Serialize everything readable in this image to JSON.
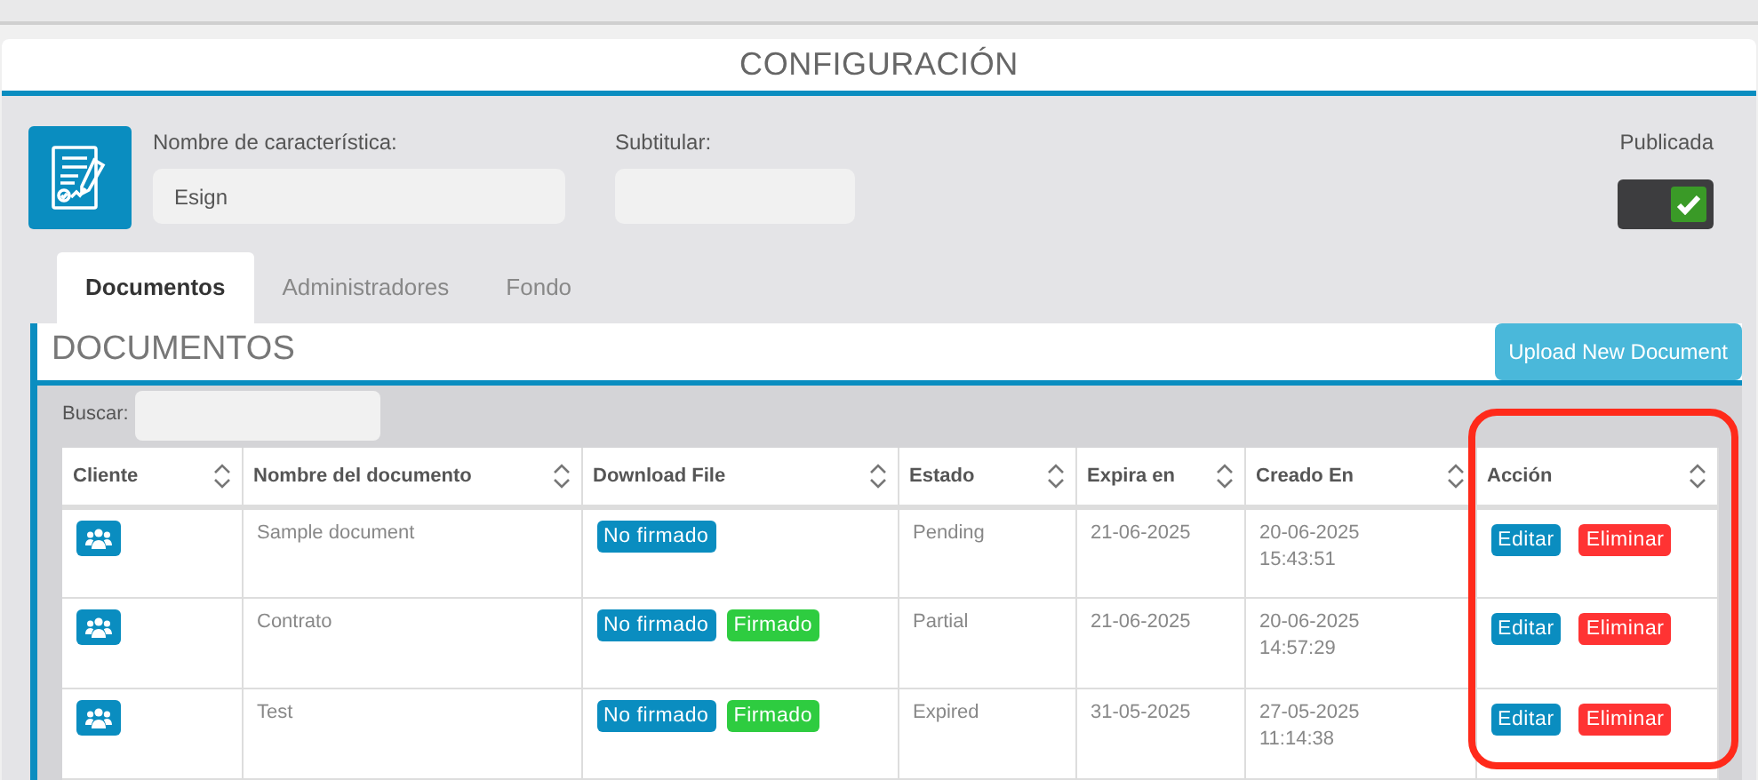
{
  "page_title": "CONFIGURACIÓN",
  "feature": {
    "name_label": "Nombre de característica:",
    "name_value": "Esign",
    "subtitle_label": "Subtitular:",
    "published_label": "Publicada",
    "published": true
  },
  "tabs": [
    {
      "label": "Documentos",
      "selected": true
    },
    {
      "label": "Administradores",
      "selected": false
    },
    {
      "label": "Fondo",
      "selected": false
    }
  ],
  "section": {
    "title": "DOCUMENTOS",
    "upload_button": "Upload New Document",
    "search_label": "Buscar:"
  },
  "table": {
    "columns": [
      {
        "label": "Cliente",
        "highlighted": false
      },
      {
        "label": "Nombre del documento",
        "highlighted": false
      },
      {
        "label": "Download File",
        "highlighted": false
      },
      {
        "label": "Estado",
        "highlighted": false
      },
      {
        "label": "Expira en",
        "highlighted": false
      },
      {
        "label": "Creado En",
        "highlighted": false
      },
      {
        "label": "Acción",
        "highlighted": true
      }
    ],
    "rows": [
      {
        "name": "Sample document",
        "files": [
          {
            "label": "No firmado",
            "kind": "unsigned"
          }
        ],
        "status": "Pending",
        "expires": "21-06-2025",
        "created": [
          "20-06-2025",
          "15:43:51"
        ],
        "actions": [
          {
            "label": "Editar",
            "kind": "edit"
          },
          {
            "label": "Eliminar",
            "kind": "delete"
          }
        ]
      },
      {
        "name": "Contrato",
        "files": [
          {
            "label": "No firmado",
            "kind": "unsigned"
          },
          {
            "label": "Firmado",
            "kind": "signed"
          }
        ],
        "status": "Partial",
        "expires": "21-06-2025",
        "created": [
          "20-06-2025",
          "14:57:29"
        ],
        "actions": [
          {
            "label": "Editar",
            "kind": "edit"
          },
          {
            "label": "Eliminar",
            "kind": "delete"
          }
        ]
      },
      {
        "name": "Test",
        "files": [
          {
            "label": "No firmado",
            "kind": "unsigned"
          },
          {
            "label": "Firmado",
            "kind": "signed"
          }
        ],
        "status": "Expired",
        "expires": "31-05-2025",
        "created": [
          "27-05-2025",
          "11:14:38"
        ],
        "actions": [
          {
            "label": "Editar",
            "kind": "edit"
          },
          {
            "label": "Eliminar",
            "kind": "delete"
          }
        ]
      }
    ]
  }
}
